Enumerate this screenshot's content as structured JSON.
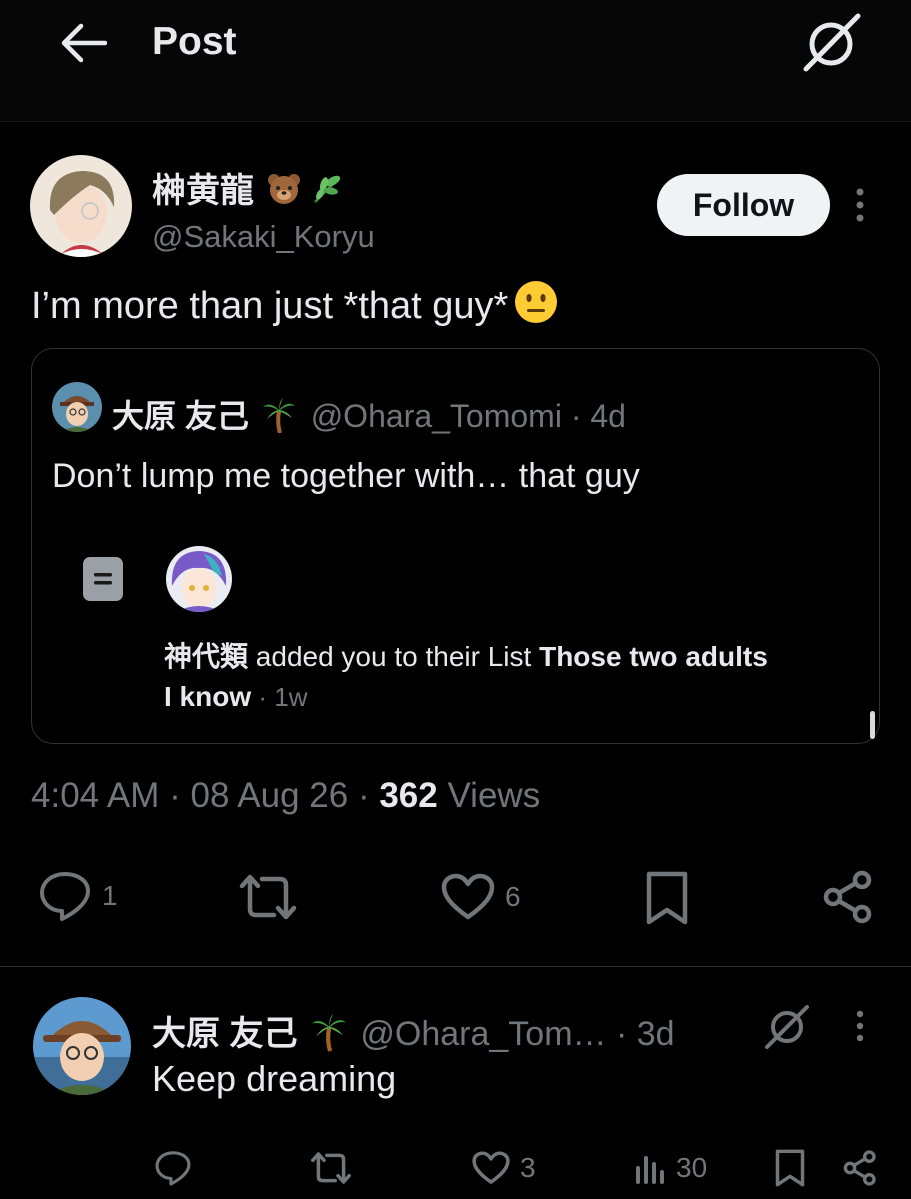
{
  "header": {
    "title": "Post"
  },
  "post": {
    "author_name": "榊黄龍",
    "author_emojis": [
      "bear",
      "herb"
    ],
    "author_handle": "@Sakaki_Koryu",
    "follow_label": "Follow",
    "text": "I’m more than just *that guy*",
    "text_emoji": "neutral-face",
    "quote": {
      "name": "大原 友己",
      "name_emoji": "palm-tree",
      "handle": "@Ohara_Tomomi",
      "time": "4d",
      "text": "Don’t lump me together with… that guy",
      "notification": {
        "actor": "神代類",
        "action": " added you to their List ",
        "list_name_line1": "Those two adults",
        "list_name_line2": "I know",
        "time": "1w"
      }
    },
    "time": "4:04 AM",
    "date": "08 Aug 26",
    "views_count": "362",
    "views_label": "Views",
    "actions": {
      "replies": "1",
      "reposts": "",
      "likes": "6"
    }
  },
  "reply": {
    "name": "大原 友己",
    "name_emoji": "palm-tree",
    "handle": "@Ohara_Tom…",
    "time": "3d",
    "text": "Keep dreaming",
    "actions": {
      "replies": "",
      "reposts": "",
      "likes": "3",
      "views": "30"
    }
  },
  "colors": {
    "background": "#000000",
    "text_primary": "#e7e9ea",
    "text_secondary": "#71767b",
    "border": "#2f3336",
    "follow_bg": "#eff3f4"
  }
}
